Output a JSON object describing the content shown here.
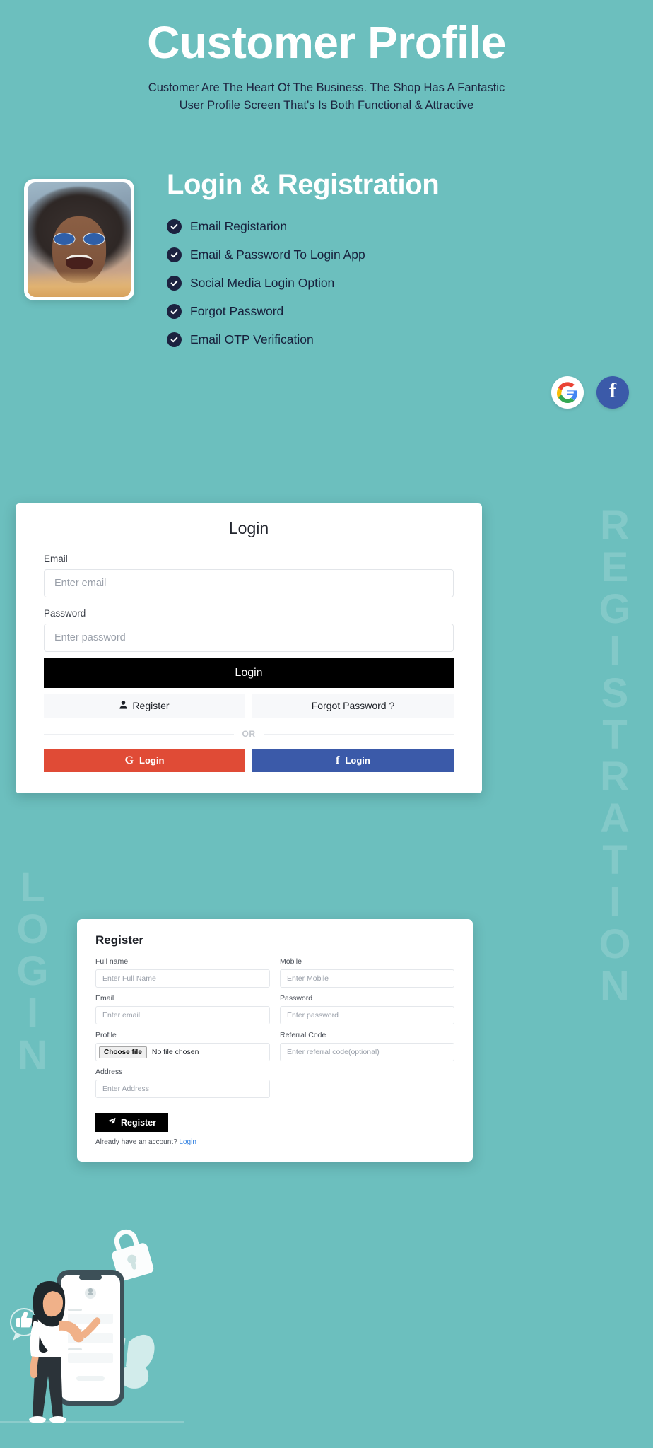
{
  "theme": {
    "background": "#6cbfbe",
    "heading_color": "#ffffff",
    "body_text_color": "#1d2440",
    "accent_dark": "#000000",
    "google_red": "#e04b36",
    "facebook_blue": "#3b5aa9",
    "link_blue": "#2f7fe0"
  },
  "header": {
    "title": "Customer Profile",
    "subtitle_line1": "Customer Are The Heart Of The Business. The Shop Has A Fantastic",
    "subtitle_line2": "User Profile Screen That's Is Both Functional & Attractive"
  },
  "watermarks": {
    "right": "REGISTRATION",
    "left": "LOGIN"
  },
  "feature_section": {
    "heading": "Login & Registration",
    "items": [
      {
        "label": "Email Registarion"
      },
      {
        "label": "Email & Password To Login App"
      },
      {
        "label": "Social Media Login Option"
      },
      {
        "label": "Forgot Password"
      },
      {
        "label": "Email OTP Verification"
      }
    ],
    "social_icons": [
      {
        "name": "google-icon",
        "label": "G"
      },
      {
        "name": "facebook-icon",
        "label": "f"
      }
    ]
  },
  "login_card": {
    "title": "Login",
    "email_label": "Email",
    "email_placeholder": "Enter email",
    "password_label": "Password",
    "password_placeholder": "Enter password",
    "login_button": "Login",
    "register_button": "Register",
    "forgot_button": "Forgot Password ?",
    "or_text": "OR",
    "google_button": "Login",
    "google_icon_letter": "G",
    "facebook_button": "Login",
    "facebook_icon_letter": "f"
  },
  "register_card": {
    "title": "Register",
    "fields": {
      "fullname_label": "Full name",
      "fullname_placeholder": "Enter Full Name",
      "mobile_label": "Mobile",
      "mobile_placeholder": "Enter Mobile",
      "email_label": "Email",
      "email_placeholder": "Enter email",
      "password_label": "Password",
      "password_placeholder": "Enter password",
      "profile_label": "Profile",
      "profile_button": "Choose file",
      "profile_status": "No file chosen",
      "referral_label": "Referral Code",
      "referral_placeholder": "Enter referral code(optional)",
      "address_label": "Address",
      "address_placeholder": "Enter Address"
    },
    "submit_button": "Register",
    "account_text": "Already have an account?",
    "account_link": "Login"
  }
}
